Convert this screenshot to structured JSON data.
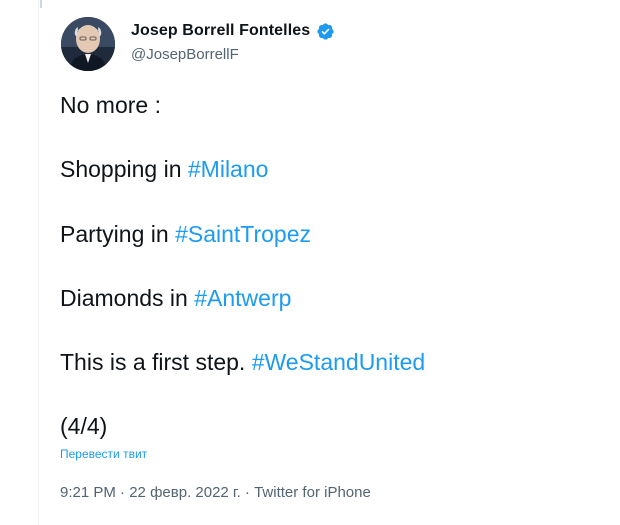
{
  "author": {
    "display_name": "Josep Borrell Fontelles",
    "handle": "@JosepBorrellF",
    "verified": true,
    "avatar_icon": "profile-photo"
  },
  "tweet": {
    "lines": [
      {
        "text": "No more :",
        "hashtag": ""
      },
      {
        "text": "Shopping in ",
        "hashtag": "#Milano"
      },
      {
        "text": "Partying in ",
        "hashtag": "#SaintTropez"
      },
      {
        "text": "Diamonds in ",
        "hashtag": "#Antwerp"
      },
      {
        "text": "This is a first step. ",
        "hashtag": "#WeStandUnited"
      },
      {
        "text": "(4/4)",
        "hashtag": ""
      }
    ],
    "translate_label": "Перевести твит"
  },
  "meta": {
    "time": "9:21 PM",
    "separator": " · ",
    "date": "22 февр. 2022 г.",
    "source": "Twitter for iPhone"
  },
  "colors": {
    "hashtag": "#1d9bf0",
    "verified": "#1d9bf0",
    "secondary_text": "#536471"
  }
}
